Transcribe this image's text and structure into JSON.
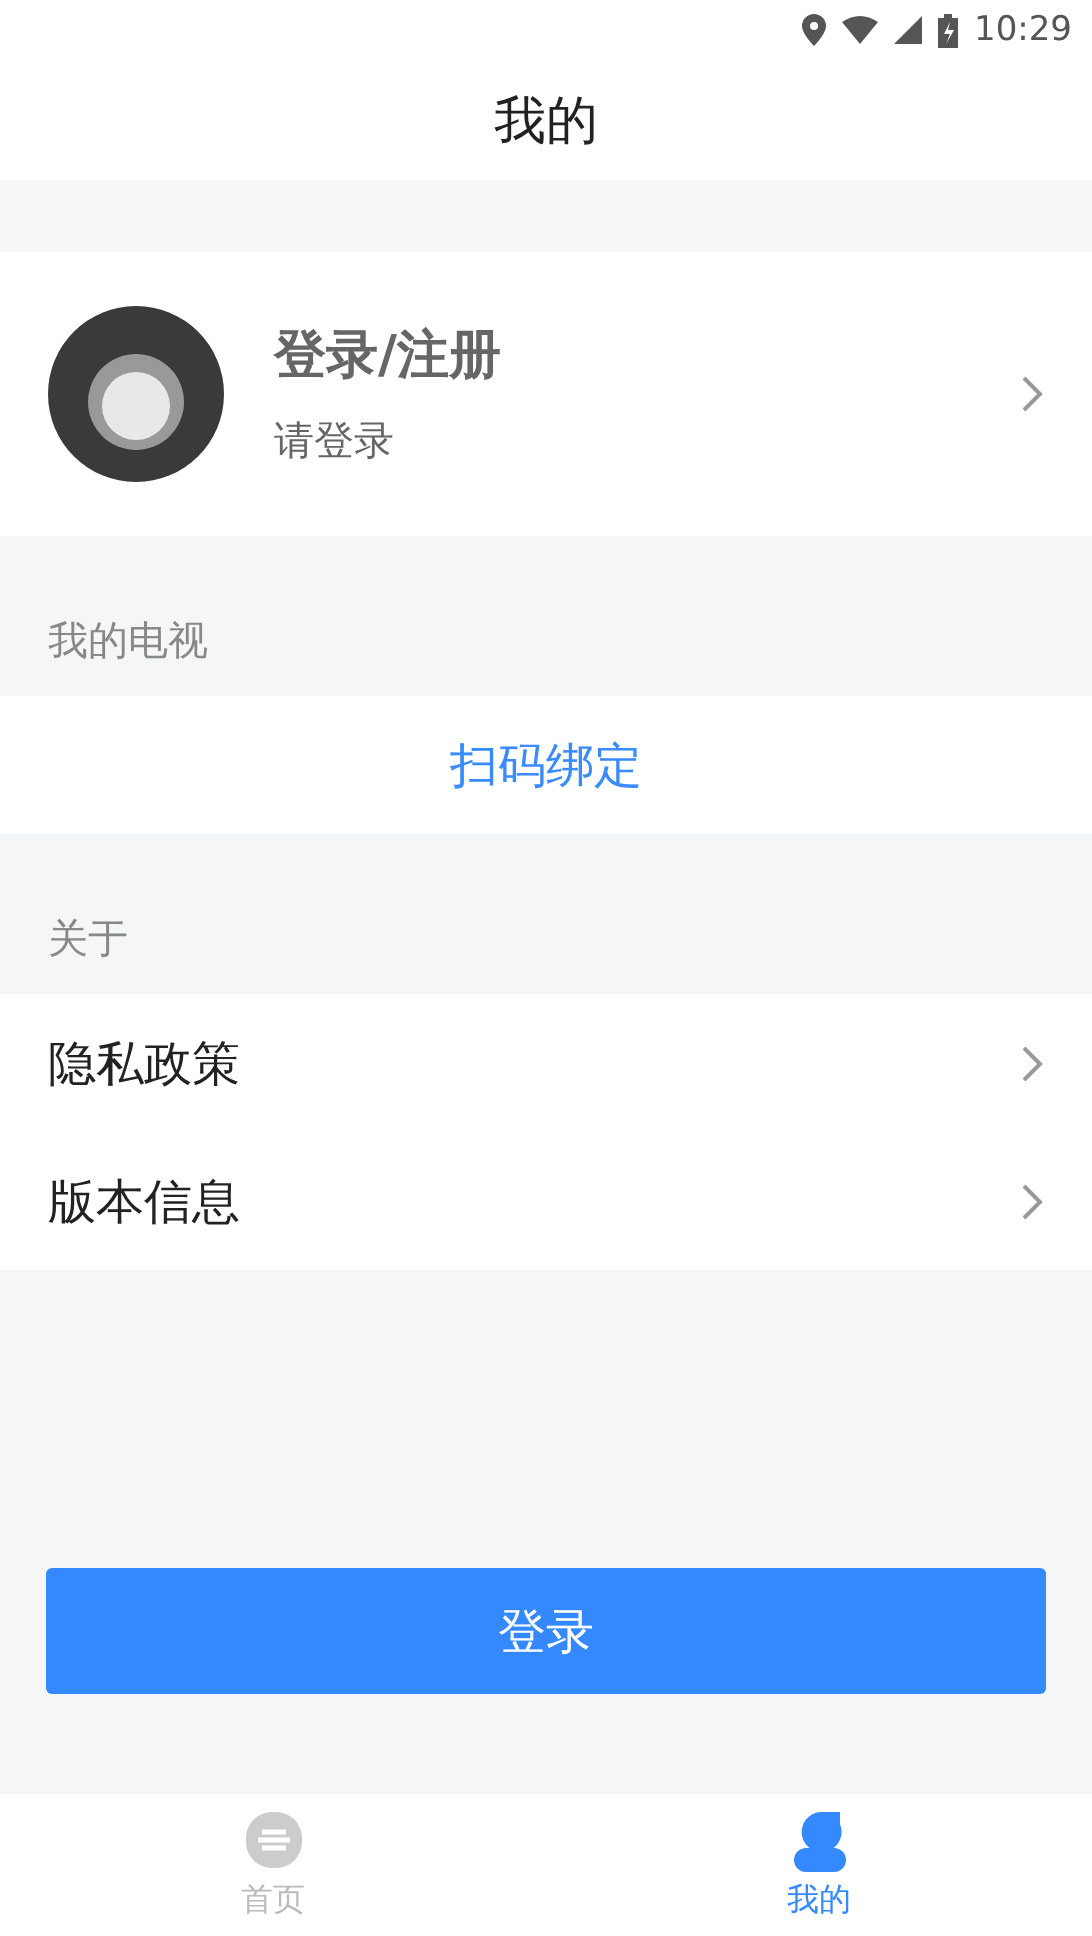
{
  "status_bar": {
    "time": "10:29"
  },
  "header": {
    "title": "我的"
  },
  "profile": {
    "name": "登录/注册",
    "subtitle": "请登录"
  },
  "tv_section": {
    "label": "我的电视",
    "action": "扫码绑定"
  },
  "about_section": {
    "label": "关于",
    "items": [
      {
        "label": "隐私政策"
      },
      {
        "label": "版本信息"
      }
    ]
  },
  "login_button": "登录",
  "tab_bar": [
    {
      "label": "首页",
      "selected": false,
      "kind": "home"
    },
    {
      "label": "我的",
      "selected": true,
      "kind": "profile"
    }
  ]
}
